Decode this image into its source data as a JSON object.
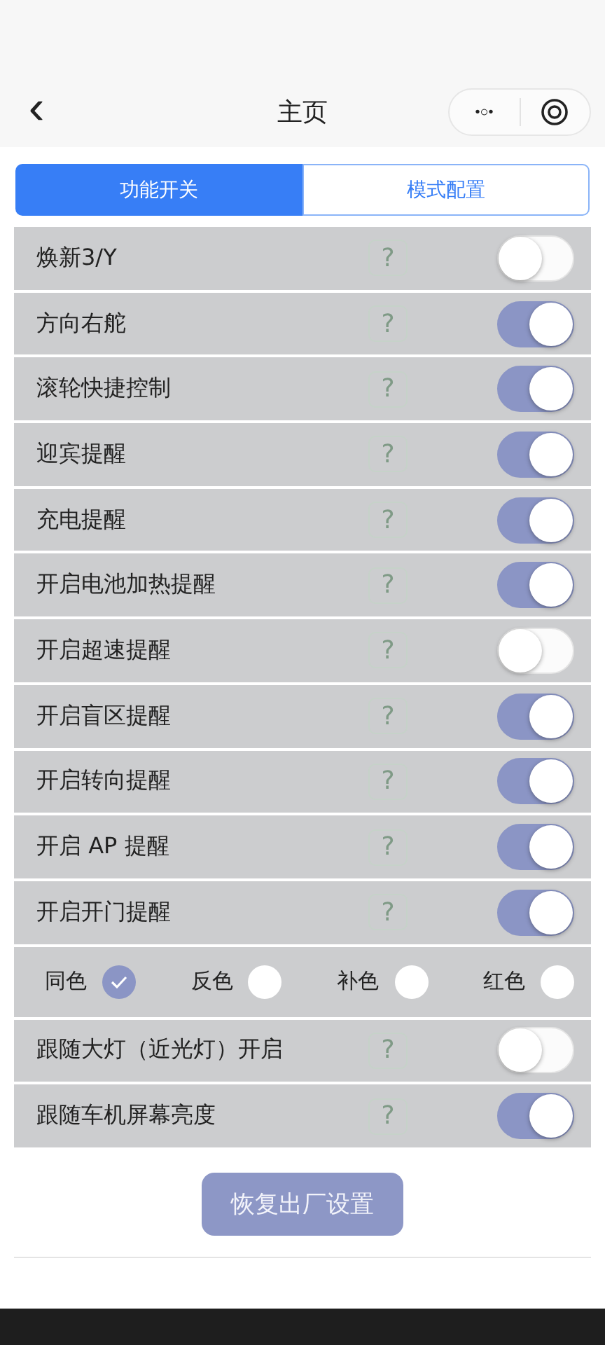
{
  "nav": {
    "back": "‹",
    "title": "主页",
    "menu": "•○•"
  },
  "tabs": [
    {
      "label": "功能开关",
      "selected": true
    },
    {
      "label": "模式配置",
      "selected": false
    }
  ],
  "rows": [
    {
      "kind": "toggle",
      "label": "焕新3/Y",
      "hint": "?",
      "on": false
    },
    {
      "kind": "toggle",
      "label": "方向右舵",
      "hint": "?",
      "on": true
    },
    {
      "kind": "toggle",
      "label": "滚轮快捷控制",
      "hint": "?",
      "on": true
    },
    {
      "kind": "toggle",
      "label": "迎宾提醒",
      "hint": "?",
      "on": true
    },
    {
      "kind": "toggle",
      "label": "充电提醒",
      "hint": "?",
      "on": true
    },
    {
      "kind": "toggle",
      "label": "开启电池加热提醒",
      "hint": "?",
      "on": true
    },
    {
      "kind": "toggle",
      "label": "开启超速提醒",
      "hint": "?",
      "on": false
    },
    {
      "kind": "toggle",
      "label": "开启盲区提醒",
      "hint": "?",
      "on": true
    },
    {
      "kind": "toggle",
      "label": "开启转向提醒",
      "hint": "?",
      "on": true
    },
    {
      "kind": "toggle",
      "label": "开启 AP 提醒",
      "hint": "?",
      "on": true
    },
    {
      "kind": "toggle",
      "label": "开启开门提醒",
      "hint": "?",
      "on": true
    },
    {
      "kind": "radios",
      "options": [
        {
          "label": "同色",
          "selected": true
        },
        {
          "label": "反色",
          "selected": false
        },
        {
          "label": "补色",
          "selected": false
        },
        {
          "label": "红色",
          "selected": false
        }
      ]
    },
    {
      "kind": "toggle",
      "label": "跟随大灯（近光灯）开启",
      "hint": "?",
      "on": false
    },
    {
      "kind": "toggle",
      "label": "跟随车机屏幕亮度",
      "hint": "?",
      "on": true
    }
  ],
  "reset_button": "恢复出厂设置"
}
